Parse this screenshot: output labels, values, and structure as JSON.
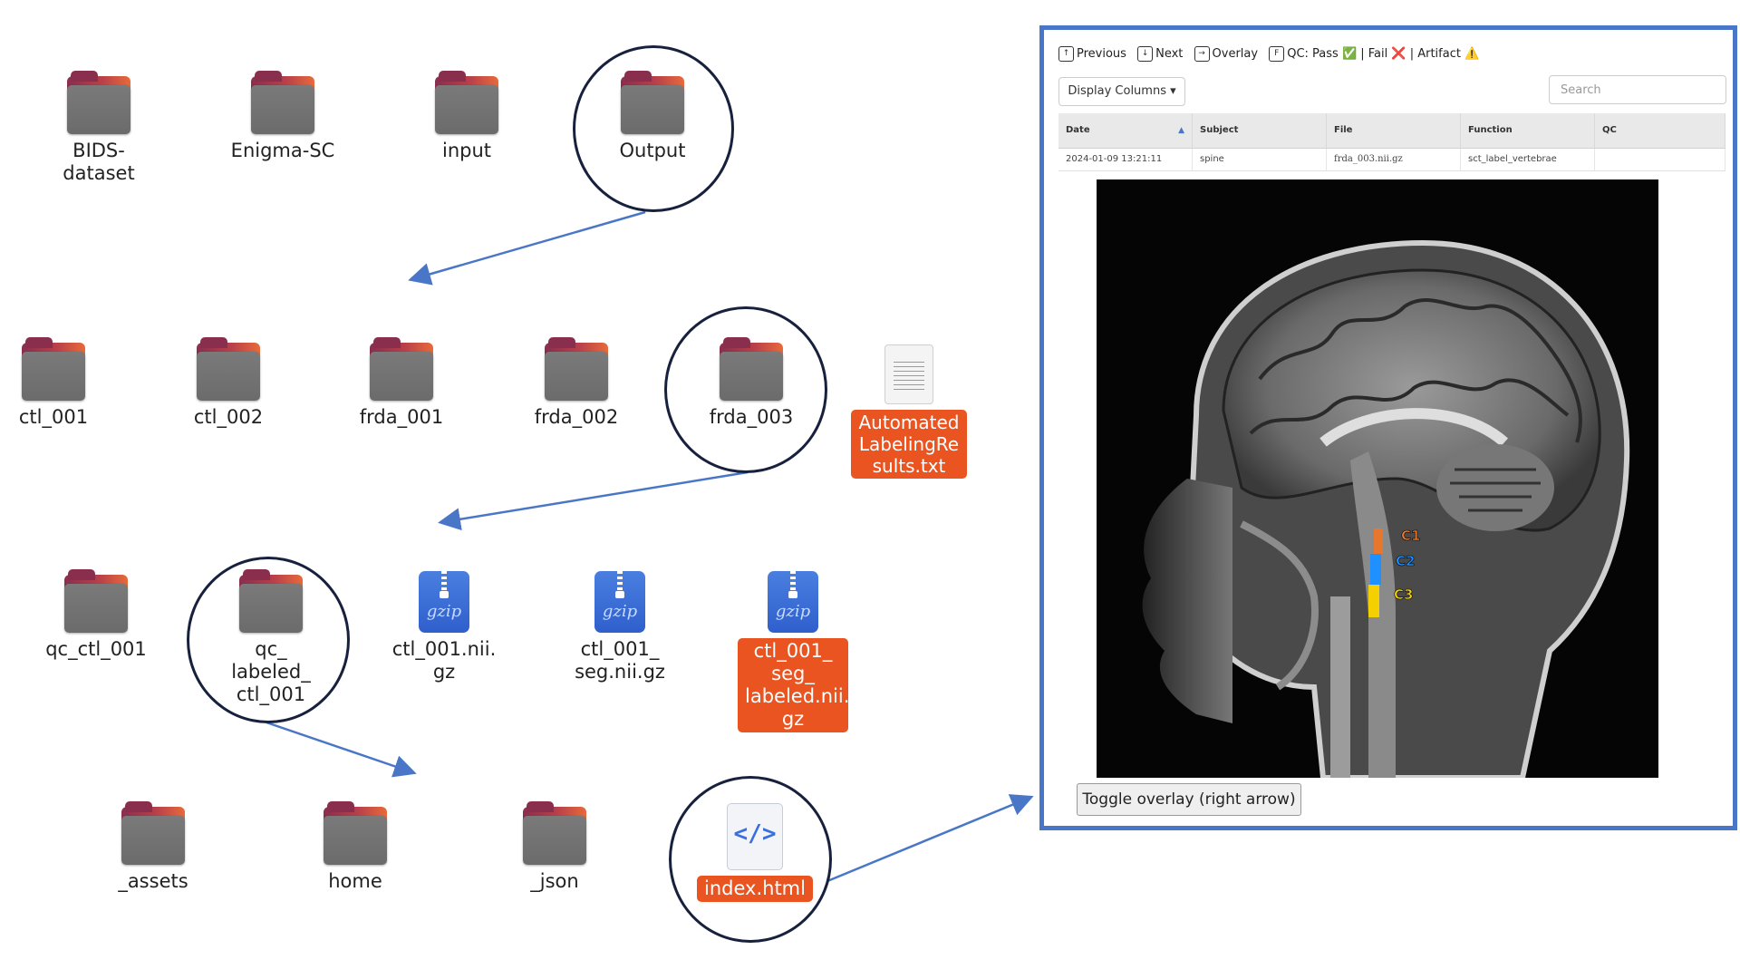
{
  "row1": {
    "folders": [
      "BIDS-\ndataset",
      "Enigma-SC",
      "input",
      "Output"
    ]
  },
  "row2": {
    "folders": [
      "ctl_001",
      "ctl_002",
      "frda_001",
      "frda_002",
      "frda_003"
    ],
    "text_file": "Automated\nLabelingRe\nsults.txt"
  },
  "row3": {
    "folders": [
      "qc_ctl_001",
      "qc_\nlabeled_\nctl_001"
    ],
    "gz_files": [
      "ctl_001.nii.\ngz",
      "ctl_001_\nseg.nii.gz",
      "ctl_001_\nseg_\nlabeled.nii.\ngz"
    ],
    "gz_icon_text": "gzip"
  },
  "row4": {
    "folders": [
      "_assets",
      "home",
      "_json"
    ],
    "html_file": "index.html",
    "html_icon_text": "</>"
  },
  "qc_panel": {
    "toolbar": {
      "prev_key": "↑",
      "prev_label": "Previous",
      "next_key": "↓",
      "next_label": "Next",
      "overlay_key": "→",
      "overlay_label": "Overlay",
      "qc_key": "F",
      "qc_label": "QC: Pass ✅ | Fail ❌ | Artifact ⚠️"
    },
    "display_columns_label": "Display Columns ▾",
    "search_placeholder": "Search",
    "columns": [
      "Date",
      "Subject",
      "File",
      "Function",
      "QC"
    ],
    "rows": [
      [
        "2024-01-09 13:21:11",
        "spine",
        "frda_003.nii.gz",
        "sct_label_vertebrae",
        ""
      ]
    ],
    "vertebra_labels": [
      "C1",
      "C2",
      "C3"
    ],
    "toggle_label": "Toggle overlay (right arrow)",
    "colors": {
      "panel_border": "#4a76c7",
      "selection": "#e95420",
      "arrow": "#4a76c7",
      "circle": "#17213d",
      "c1": "#e8772e",
      "c2": "#1e90ff",
      "c3": "#f5d000"
    }
  }
}
